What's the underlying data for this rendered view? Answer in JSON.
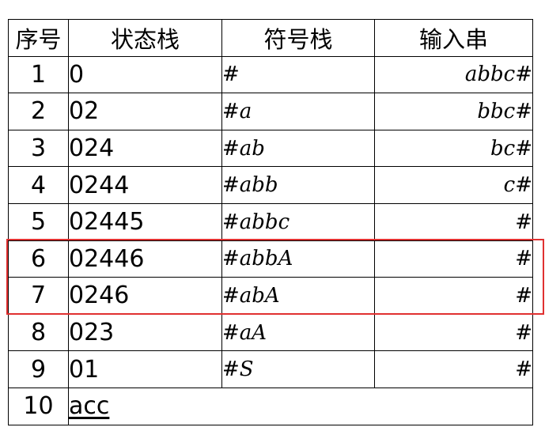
{
  "table": {
    "headers": [
      "序号",
      "状态栈",
      "符号栈",
      "输入串"
    ],
    "rows": [
      {
        "index": "1",
        "state_stack": "0",
        "symbol_stack": "#",
        "input": "abbc#"
      },
      {
        "index": "2",
        "state_stack": "02",
        "symbol_stack": "#a",
        "input": "bbc#"
      },
      {
        "index": "3",
        "state_stack": "024",
        "symbol_stack": "#ab",
        "input": "bc#"
      },
      {
        "index": "4",
        "state_stack": "0244",
        "symbol_stack": "#abb",
        "input": "c#"
      },
      {
        "index": "5",
        "state_stack": "02445",
        "symbol_stack": "#abbc",
        "input": "#"
      },
      {
        "index": "6",
        "state_stack": "02446",
        "symbol_stack": "#abbA",
        "input": "#"
      },
      {
        "index": "7",
        "state_stack": "0246",
        "symbol_stack": "#abA",
        "input": "#"
      },
      {
        "index": "8",
        "state_stack": "023",
        "symbol_stack": "#aA",
        "input": "#"
      },
      {
        "index": "9",
        "state_stack": "01",
        "symbol_stack": "#S",
        "input": "#"
      }
    ],
    "final_row": {
      "index": "10",
      "result": "acc"
    }
  },
  "highlight": {
    "color": "#e03030",
    "rows": [
      "6",
      "7"
    ]
  }
}
